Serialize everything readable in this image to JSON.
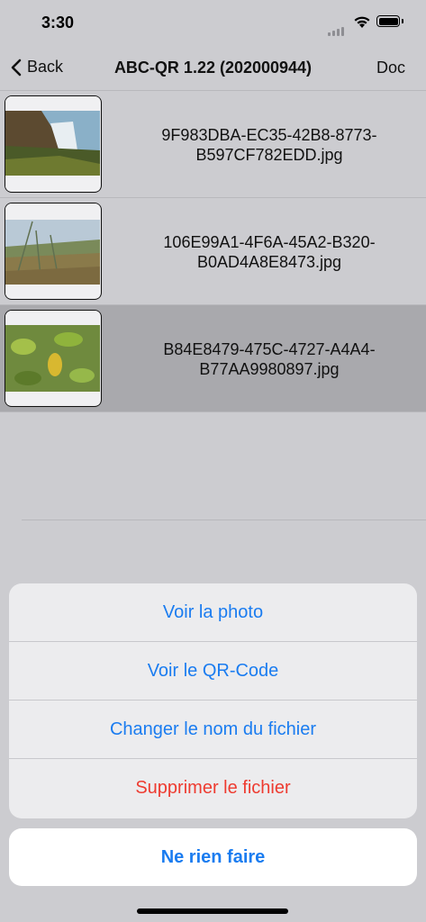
{
  "status": {
    "time": "3:30"
  },
  "nav": {
    "back_label": "Back",
    "title": "ABC-QR 1.22 (202000944)",
    "doc_label": "Doc"
  },
  "files": [
    {
      "name_line1": "9F983DBA-EC35-42B8-8773-",
      "name_line2": "B597CF782EDD.jpg",
      "thumb": "waterfall-landscape"
    },
    {
      "name_line1": "106E99A1-4F6A-45A2-B320-",
      "name_line2": "B0AD4A8E8473.jpg",
      "thumb": "grass-hillside"
    },
    {
      "name_line1": "B84E8479-475C-4727-A4A4-",
      "name_line2": "B77AA9980897.jpg",
      "thumb": "green-leaves",
      "selected": true
    }
  ],
  "action_sheet": {
    "actions": [
      "Voir la photo",
      "Voir le QR-Code",
      "Changer le nom du fichier",
      "Supprimer le fichier"
    ],
    "cancel": "Ne rien faire"
  },
  "colors": {
    "accent": "#1a7cf0",
    "destructive": "#ee3b30"
  }
}
